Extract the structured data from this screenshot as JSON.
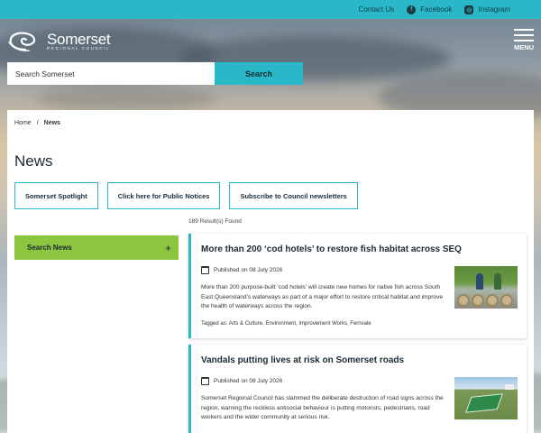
{
  "topbar": {
    "contact": "Contact Us",
    "facebook": "Facebook",
    "instagram": "Instagram",
    "facebook_icon_glyph": "f",
    "instagram_icon_glyph": "◎"
  },
  "header": {
    "brand": "Somerset",
    "brand_sub": "Regional Council",
    "menu_label": "MENU"
  },
  "search": {
    "placeholder": "Search Somerset",
    "button": "Search"
  },
  "breadcrumb": {
    "home": "Home",
    "separator": "/",
    "current": "News"
  },
  "page": {
    "title": "News",
    "results": "189 Result(s) Found"
  },
  "quick_links": [
    {
      "label": "Somerset Spotlight"
    },
    {
      "label": "Click here for Public Notices"
    },
    {
      "label": "Subscribe to Council newsletters"
    }
  ],
  "sidebar": {
    "search_news": "Search News",
    "toggle": "+"
  },
  "articles": [
    {
      "title": "More than 200 ‘cod hotels’ to restore fish habitat across SEQ",
      "published": "Published on 08 July 2026",
      "excerpt": "More than 200 purpose-built ‘cod hotels’ will create new homes for native fish across South East Queensland’s waterways as part of a major effort to restore critical habitat and improve the health of waterways across the region.",
      "tags": "Tagged as: Arts & Culture, Environment, Improvement Works, Fernvale"
    },
    {
      "title": "Vandals putting lives at risk on Somerset roads",
      "published": "Published on 08 July 2026",
      "excerpt": "Somerset Regional Council has slammed the deliberate destruction of road signs across the region, warning the reckless antisocial behaviour is putting motorists, pedestrians, road workers and the wider community at serious risk."
    }
  ],
  "colors": {
    "accent": "#2ab8c8",
    "sidebar_green": "#8cc63f"
  }
}
